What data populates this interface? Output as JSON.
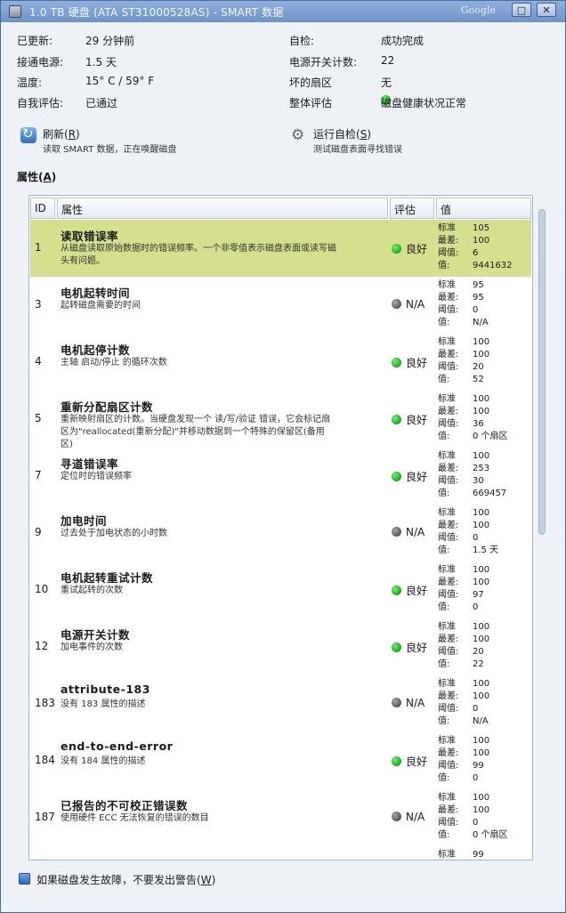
{
  "window": {
    "title": "1.0 TB 硬盘 (ATA ST31000528AS) - SMART 数据",
    "brand": "Google",
    "restore_glyph": "□",
    "close_glyph": "✕"
  },
  "info": {
    "updated_label": "已更新:",
    "updated_value": "29 分钟前",
    "selftest_label": "自检:",
    "selftest_value": "成功完成",
    "poweron_label": "接通电源:",
    "poweron_value": "1.5 天",
    "powercycle_label": "电源开关计数:",
    "powercycle_value": "22",
    "temp_label": "温度:",
    "temp_value": "15° C / 59° F",
    "badsectors_label": "坏的扇区",
    "badsectors_value": "无",
    "selfassess_label": "自我评估:",
    "selfassess_value": "已通过",
    "overall_label": "整体评估",
    "overall_value": "磁盘健康状况正常",
    "overall_status_color": "#22bb22"
  },
  "actions": {
    "refresh_title": "刷新(",
    "refresh_key": "R",
    "refresh_title_end": ")",
    "refresh_desc": "读取 SMART 数据，正在唤醒磁盘",
    "refresh_icon": "refresh-icon",
    "selftest_title": "运行自检(",
    "selftest_key": "S",
    "selftest_title_end": ")",
    "selftest_desc": "测试磁盘表面寻找错误",
    "selftest_icon": "gears-icon"
  },
  "attributes": {
    "heading": "属性(",
    "heading_key": "A",
    "heading_end": ")",
    "columns": {
      "id": "ID",
      "attr": "属性",
      "assess": "评估",
      "value": "值"
    },
    "value_keys": {
      "norm": "标准",
      "worst": "最差:",
      "thresh": "阈值:",
      "raw": "值:"
    },
    "rows": [
      {
        "id": "1",
        "name": "读取错误率",
        "desc": "从磁盘读取原始数据时的错误频率。一个非零值表示磁盘表面或读写磁头有问题。",
        "assess": "良好",
        "status": "good",
        "norm": "105",
        "worst": "100",
        "thresh": "6",
        "raw": "9441632",
        "selected": true
      },
      {
        "id": "3",
        "name": "电机起转时间",
        "desc": "起转磁盘需要的时间",
        "assess": "N/A",
        "status": "na",
        "norm": "95",
        "worst": "95",
        "thresh": "0",
        "raw": "N/A"
      },
      {
        "id": "4",
        "name": "电机起停计数",
        "desc": "主轴 启动/停止 的循环次数",
        "assess": "良好",
        "status": "good",
        "norm": "100",
        "worst": "100",
        "thresh": "20",
        "raw": "52"
      },
      {
        "id": "5",
        "name": "重新分配扇区计数",
        "desc": "重新映射扇区的计数。当硬盘发现一个 读/写/验证 错误，它会标记扇区为\"reallocated(重新分配)\"并移动数据到一个特殊的保留区(备用区)",
        "assess": "良好",
        "status": "good",
        "norm": "100",
        "worst": "100",
        "thresh": "36",
        "raw": "0 个扇区"
      },
      {
        "id": "7",
        "name": "寻道错误率",
        "desc": "定位时的错误频率",
        "assess": "良好",
        "status": "good",
        "norm": "100",
        "worst": "253",
        "thresh": "30",
        "raw": "669457"
      },
      {
        "id": "9",
        "name": "加电时间",
        "desc": "过去处于加电状态的小时数",
        "assess": "N/A",
        "status": "na",
        "norm": "100",
        "worst": "100",
        "thresh": "0",
        "raw": "1.5 天"
      },
      {
        "id": "10",
        "name": "电机起转重试计数",
        "desc": "重试起转的次数",
        "assess": "良好",
        "status": "good",
        "norm": "100",
        "worst": "100",
        "thresh": "97",
        "raw": "0"
      },
      {
        "id": "12",
        "name": "电源开关计数",
        "desc": "加电事件的次数",
        "assess": "良好",
        "status": "good",
        "norm": "100",
        "worst": "100",
        "thresh": "20",
        "raw": "22"
      },
      {
        "id": "183",
        "name": "attribute-183",
        "desc": "没有 183 属性的描述",
        "assess": "N/A",
        "status": "na",
        "norm": "100",
        "worst": "100",
        "thresh": "0",
        "raw": "N/A"
      },
      {
        "id": "184",
        "name": "end-to-end-error",
        "desc": "没有 184 属性的描述",
        "assess": "良好",
        "status": "good",
        "norm": "100",
        "worst": "100",
        "thresh": "99",
        "raw": "0"
      },
      {
        "id": "187",
        "name": "已报告的不可校正错误数",
        "desc": "使用硬件 ECC 无法恢复的错误的数目",
        "assess": "N/A",
        "status": "na",
        "norm": "100",
        "worst": "100",
        "thresh": "0",
        "raw": "0 个扇区"
      },
      {
        "id": "",
        "name": "",
        "desc": "",
        "assess": "",
        "status": "",
        "norm": "99",
        "worst": "",
        "thresh": "",
        "raw": "",
        "partial": true
      }
    ]
  },
  "footer": {
    "checkbox_label": "如果磁盘发生故障，不要发出警告(",
    "checkbox_key": "W",
    "checkbox_label_end": ")",
    "checked": true
  },
  "colors": {
    "good": "#22bb22",
    "na": "#666666",
    "selected_row": "#d5df8e"
  }
}
